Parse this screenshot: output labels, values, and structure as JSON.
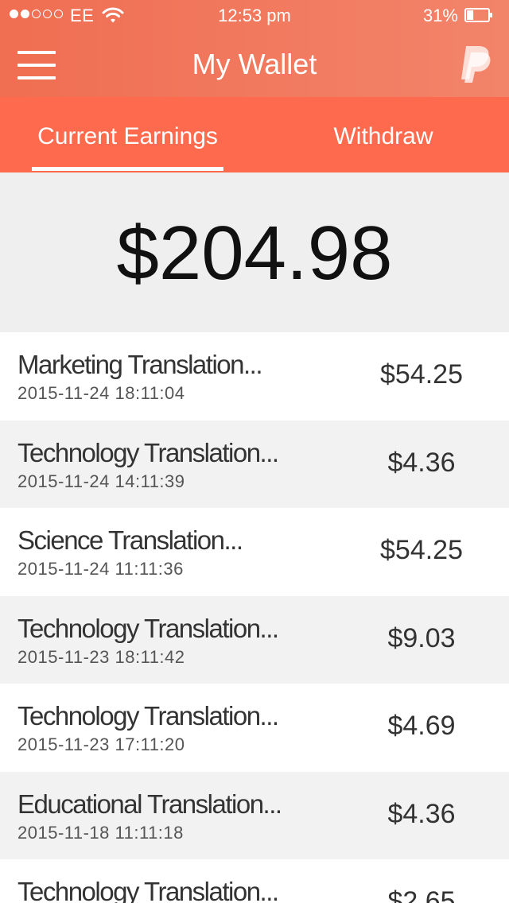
{
  "status_bar": {
    "carrier": "EE",
    "time": "12:53 pm",
    "battery_percent": "31%",
    "battery_level": 0.31,
    "signal_strength": 2,
    "signal_max": 5
  },
  "header": {
    "title": "My Wallet",
    "menu_icon": "hamburger-menu-icon",
    "logo_icon": "paypal-logo-icon"
  },
  "tabs": [
    {
      "label": "Current Earnings",
      "active": true
    },
    {
      "label": "Withdraw",
      "active": false
    }
  ],
  "balance": {
    "amount": "$204.98"
  },
  "transactions": [
    {
      "title": "Marketing Translation...",
      "date": "2015-11-24 18:11:04",
      "amount": "$54.25"
    },
    {
      "title": "Technology Translation...",
      "date": "2015-11-24 14:11:39",
      "amount": "$4.36"
    },
    {
      "title": "Science Translation...",
      "date": "2015-11-24 11:11:36",
      "amount": "$54.25"
    },
    {
      "title": "Technology Translation...",
      "date": "2015-11-23 18:11:42",
      "amount": "$9.03"
    },
    {
      "title": "Technology Translation...",
      "date": "2015-11-23 17:11:20",
      "amount": "$4.69"
    },
    {
      "title": "Educational Translation...",
      "date": "2015-11-18 11:11:18",
      "amount": "$4.36"
    },
    {
      "title": "Technology Translation...",
      "date": "",
      "amount": "$2.65"
    }
  ],
  "colors": {
    "header_gradient_start": "#f06e52",
    "header_gradient_end": "#f2846a",
    "tab_bar": "#fd6a4e",
    "balance_background": "#efefef",
    "row_alt_background": "#f2f2f2"
  }
}
